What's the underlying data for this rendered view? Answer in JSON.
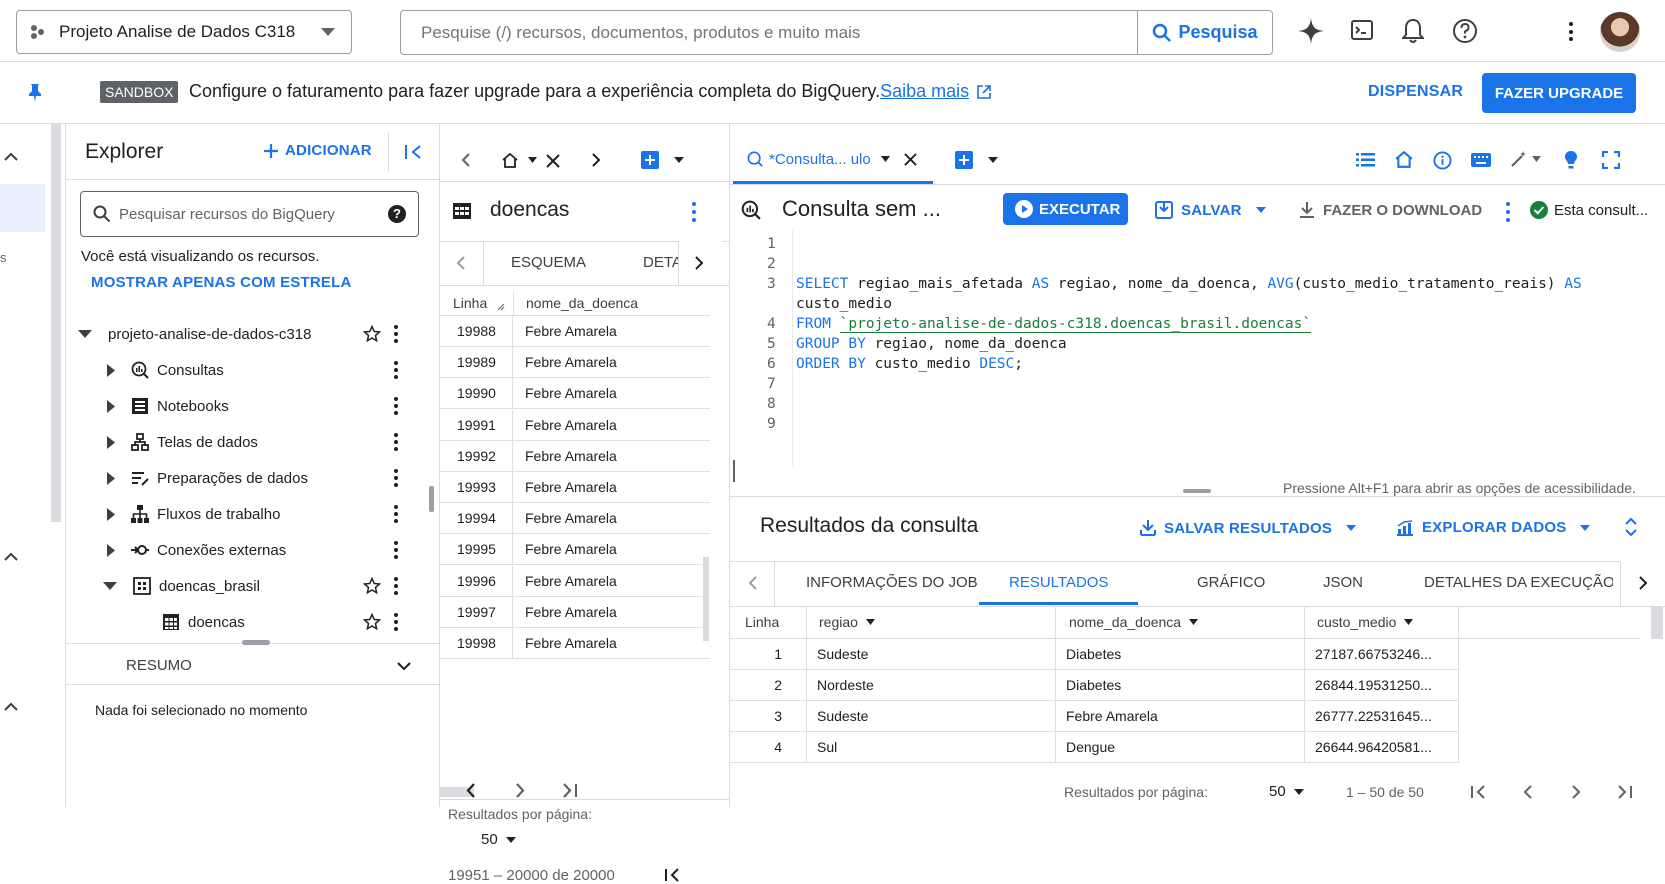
{
  "topbar": {
    "project_name": "Projeto Analise de Dados C318",
    "search_placeholder": "Pesquise (/) recursos, documentos, produtos e muito mais",
    "search_button": "Pesquisa"
  },
  "banner": {
    "badge": "SANDBOX",
    "message": "Configure o faturamento para fazer upgrade para a experiência completa do BigQuery.",
    "link": "Saiba mais",
    "dismiss": "DISPENSAR",
    "upgrade": "FAZER UPGRADE"
  },
  "explorer": {
    "title": "Explorer",
    "add_label": "ADICIONAR",
    "search_placeholder": "Pesquisar recursos do BigQuery",
    "viewing_text": "Você está visualizando os recursos.",
    "starred_link": "MOSTRAR APENAS COM ESTRELA",
    "project": "projeto-analise-de-dados-c318",
    "items": [
      {
        "label": "Consultas",
        "icon": "query-icon"
      },
      {
        "label": "Notebooks",
        "icon": "notebook-icon"
      },
      {
        "label": "Telas de dados",
        "icon": "canvas-icon"
      },
      {
        "label": "Preparações de dados",
        "icon": "data-prep-icon"
      },
      {
        "label": "Fluxos de trabalho",
        "icon": "workflow-icon"
      },
      {
        "label": "Conexões externas",
        "icon": "connection-icon"
      }
    ],
    "dataset": "doencas_brasil",
    "table": "doencas",
    "summary_label": "RESUMO",
    "summary_text": "Nada foi selecionado no momento"
  },
  "table_panel": {
    "title": "doencas",
    "tabs": [
      "ESQUEMA",
      "DETA"
    ],
    "col_line": "Linha",
    "col_name": "nome_da_doenca",
    "rows": [
      {
        "n": "19988",
        "v": "Febre Amarela"
      },
      {
        "n": "19989",
        "v": "Febre Amarela"
      },
      {
        "n": "19990",
        "v": "Febre Amarela"
      },
      {
        "n": "19991",
        "v": "Febre Amarela"
      },
      {
        "n": "19992",
        "v": "Febre Amarela"
      },
      {
        "n": "19993",
        "v": "Febre Amarela"
      },
      {
        "n": "19994",
        "v": "Febre Amarela"
      },
      {
        "n": "19995",
        "v": "Febre Amarela"
      },
      {
        "n": "19996",
        "v": "Febre Amarela"
      },
      {
        "n": "19997",
        "v": "Febre Amarela"
      },
      {
        "n": "19998",
        "v": "Febre Amarela"
      }
    ],
    "per_page_label": "Resultados por página:",
    "per_page_value": "50",
    "range": "19951 – 20000 de 20000"
  },
  "editor": {
    "tab_label": "*Consulta... ulo",
    "title": "Consulta sem ...",
    "run": "EXECUTAR",
    "save": "SALVAR",
    "download": "FAZER O DOWNLOAD",
    "status": "Esta consult...",
    "line_numbers": [
      "1",
      "2",
      "3",
      "",
      "4",
      "5",
      "6",
      "7",
      "8",
      "9"
    ],
    "a11y_hint": "Pressione Alt+F1 para abrir as opções de acessibilidade."
  },
  "results": {
    "title": "Resultados da consulta",
    "save_results": "SALVAR RESULTADOS",
    "explore": "EXPLORAR DADOS",
    "tabs": [
      "INFORMAÇÕES DO JOB",
      "RESULTADOS",
      "GRÁFICO",
      "JSON",
      "DETALHES DA EXECUÇÃO"
    ],
    "columns": [
      "Linha",
      "regiao",
      "nome_da_doenca",
      "custo_medio"
    ],
    "rows": [
      {
        "n": "1",
        "regiao": "Sudeste",
        "doenca": "Diabetes",
        "custo": "27187.66753246..."
      },
      {
        "n": "2",
        "regiao": "Nordeste",
        "doenca": "Diabetes",
        "custo": "26844.19531250..."
      },
      {
        "n": "3",
        "regiao": "Sudeste",
        "doenca": "Febre Amarela",
        "custo": "26777.22531645..."
      },
      {
        "n": "4",
        "regiao": "Sul",
        "doenca": "Dengue",
        "custo": "26644.96420581..."
      }
    ],
    "per_page_label": "Resultados por página:",
    "per_page_value": "50",
    "range": "1 – 50 de 50"
  }
}
